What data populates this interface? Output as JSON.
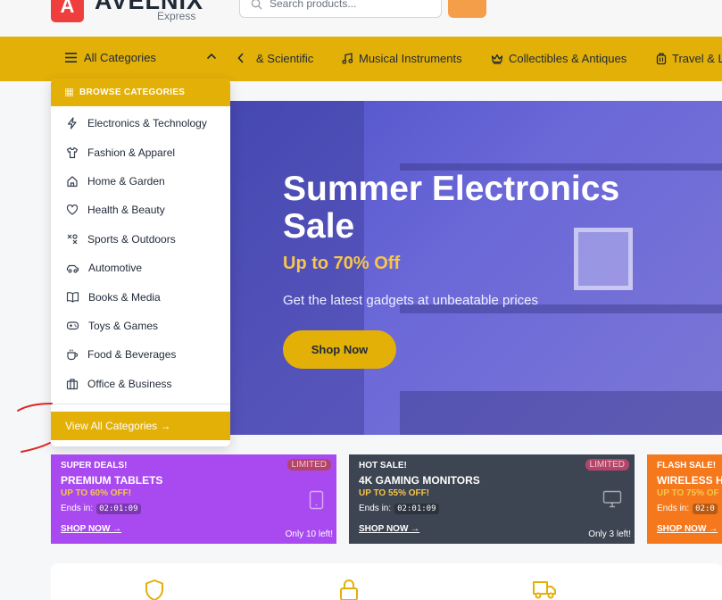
{
  "header": {
    "logo_letter": "A",
    "logo_name": "AVELNIX",
    "logo_sub": "Express",
    "search_placeholder": "Search products..."
  },
  "catbar": {
    "all_categories": "All Categories",
    "nav_items": [
      {
        "label": "& Scientific",
        "icon": "none"
      },
      {
        "label": "Musical Instruments",
        "icon": "music-icon"
      },
      {
        "label": "Collectibles & Antiques",
        "icon": "crown-icon"
      },
      {
        "label": "Travel & L",
        "icon": "luggage-icon"
      }
    ]
  },
  "dropdown": {
    "heading": "BROWSE CATEGORIES",
    "items": [
      {
        "label": "Electronics & Technology",
        "icon": "lightning-icon"
      },
      {
        "label": "Fashion & Apparel",
        "icon": "shirt-icon"
      },
      {
        "label": "Home & Garden",
        "icon": "home-icon"
      },
      {
        "label": "Health & Beauty",
        "icon": "heart-icon"
      },
      {
        "label": "Sports & Outdoors",
        "icon": "sports-icon"
      },
      {
        "label": "Automotive",
        "icon": "car-icon"
      },
      {
        "label": "Books & Media",
        "icon": "book-icon"
      },
      {
        "label": "Toys & Games",
        "icon": "gamepad-icon"
      },
      {
        "label": "Food & Beverages",
        "icon": "coffee-icon"
      },
      {
        "label": "Office & Business",
        "icon": "briefcase-icon"
      }
    ],
    "view_all": "View All Categories →"
  },
  "hero": {
    "title": "Summer Electronics Sale",
    "offer": "Up to 70% Off",
    "description": "Get the latest gadgets at unbeatable prices",
    "button": "Shop Now"
  },
  "deals": [
    {
      "kicker": "SUPER DEALS!",
      "title": "PREMIUM TABLETS",
      "sub": "UP TO 60% OFF!",
      "ends_label": "Ends in:",
      "timer": "02:01:09",
      "shop": "SHOP NOW →",
      "badge": "LIMITED",
      "left": "Only 10 left!",
      "icon": "tablet-icon",
      "color": "#a94af0"
    },
    {
      "kicker": "HOT SALE!",
      "title": "4K GAMING MONITORS",
      "sub": "UP TO 55% OFF!",
      "ends_label": "Ends in:",
      "timer": "02:01:09",
      "shop": "SHOP NOW →",
      "badge": "LIMITED",
      "left": "Only 3 left!",
      "icon": "monitor-icon",
      "color": "#3d4452"
    },
    {
      "kicker": "FLASH SALE!",
      "title": "WIRELESS H",
      "sub": "UP TO 75% OF",
      "ends_label": "Ends in:",
      "timer": "02:0",
      "shop": "SHOP NOW →",
      "badge": "",
      "left": "",
      "icon": "",
      "color": "#f5781d"
    }
  ],
  "colors": {
    "accent": "#e3b008",
    "brand_red": "#ef3e3e",
    "orange": "#f59e4a"
  }
}
